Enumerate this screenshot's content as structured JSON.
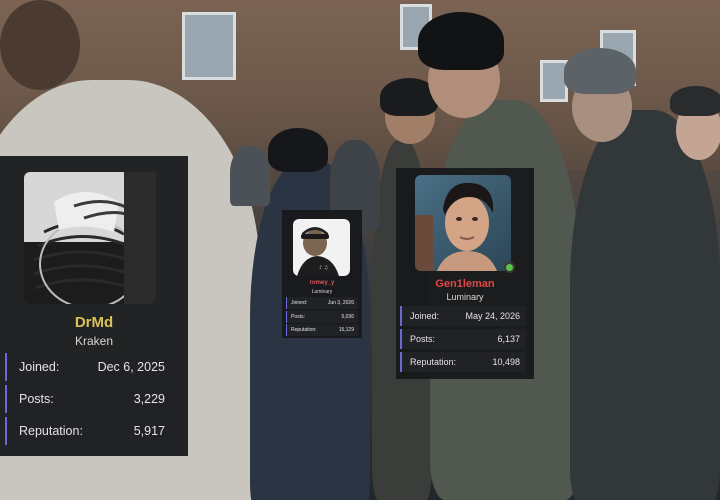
{
  "colors": {
    "accent_bar": "#6a6ad8",
    "card_bg": "#17181b",
    "row_bg": "#202226",
    "online": "#5bc24a"
  },
  "profiles": [
    {
      "username": "DrMd",
      "username_color": "#d8c456",
      "title": "Kraken",
      "stats": [
        {
          "label": "Joined:",
          "value": "Dec 6, 2025"
        },
        {
          "label": "Posts:",
          "value": "3,229"
        },
        {
          "label": "Reputation:",
          "value": "5,917"
        }
      ]
    },
    {
      "username": "romey_y",
      "username_color": "#d65a5a",
      "title": "Luminary",
      "stats": [
        {
          "label": "Joined:",
          "value": "Jun 3, 2026"
        },
        {
          "label": "Posts:",
          "value": "5,036"
        },
        {
          "label": "Reputation:",
          "value": "15,129"
        }
      ]
    },
    {
      "username": "Gen1leman",
      "username_color": "#e04848",
      "title": "Luminary",
      "online_icon": "online-status-dot",
      "stats": [
        {
          "label": "Joined:",
          "value": "May 24, 2026"
        },
        {
          "label": "Posts:",
          "value": "6,137"
        },
        {
          "label": "Reputation:",
          "value": "10,498"
        }
      ]
    }
  ]
}
